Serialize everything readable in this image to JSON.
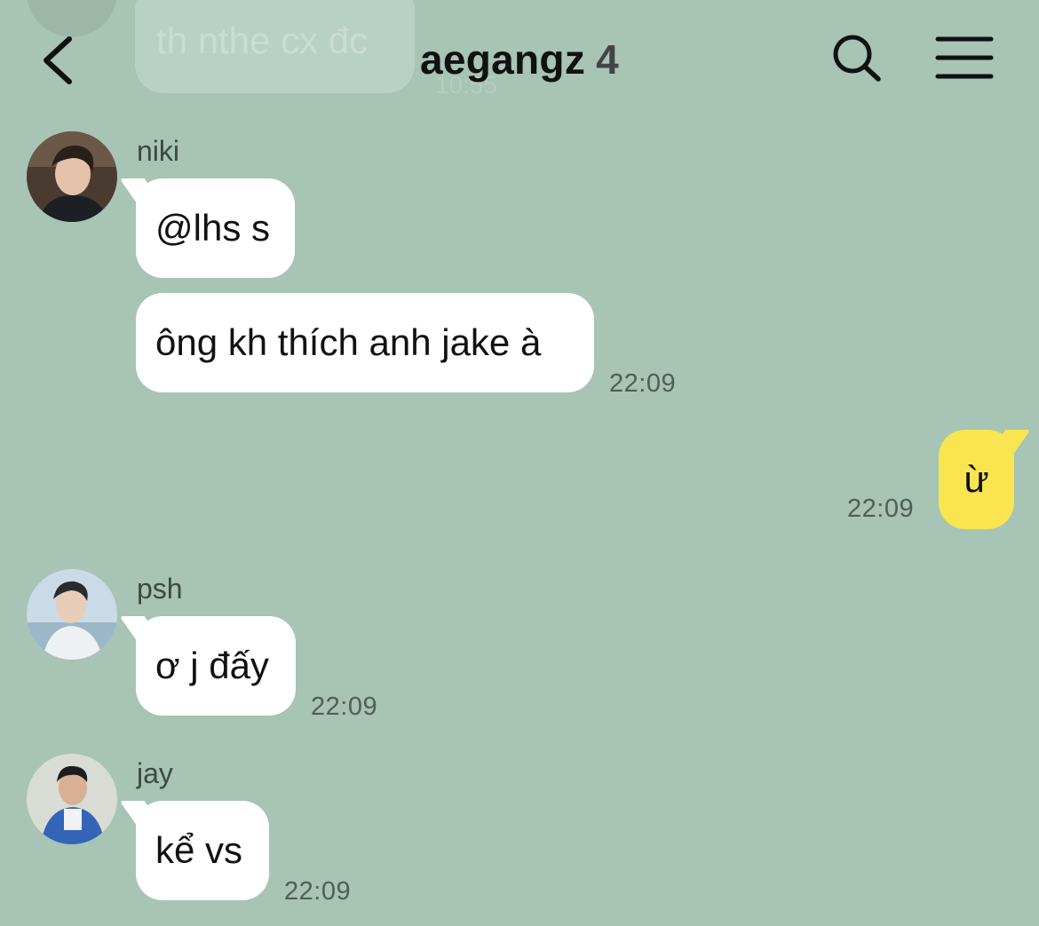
{
  "header": {
    "title": "aegangz",
    "member_count": "4",
    "back_icon": "chevron-left-icon",
    "search_icon": "search-icon",
    "menu_icon": "menu-icon"
  },
  "previous_message": {
    "text": "th nthe cx đc",
    "time": "10:55"
  },
  "messages": [
    {
      "sender": "niki",
      "bubbles": [
        "@lhs s",
        "ông kh thích anh jake à"
      ],
      "time": "22:09"
    },
    {
      "sender": "me",
      "bubbles": [
        "ừ"
      ],
      "time": "22:09"
    },
    {
      "sender": "psh",
      "bubbles": [
        "ơ j đấy"
      ],
      "time": "22:09"
    },
    {
      "sender": "jay",
      "bubbles": [
        "kể vs"
      ],
      "time": "22:09"
    }
  ],
  "colors": {
    "background": "#a7c4b5",
    "incoming_bubble": "#ffffff",
    "outgoing_bubble": "#f9e54f"
  }
}
